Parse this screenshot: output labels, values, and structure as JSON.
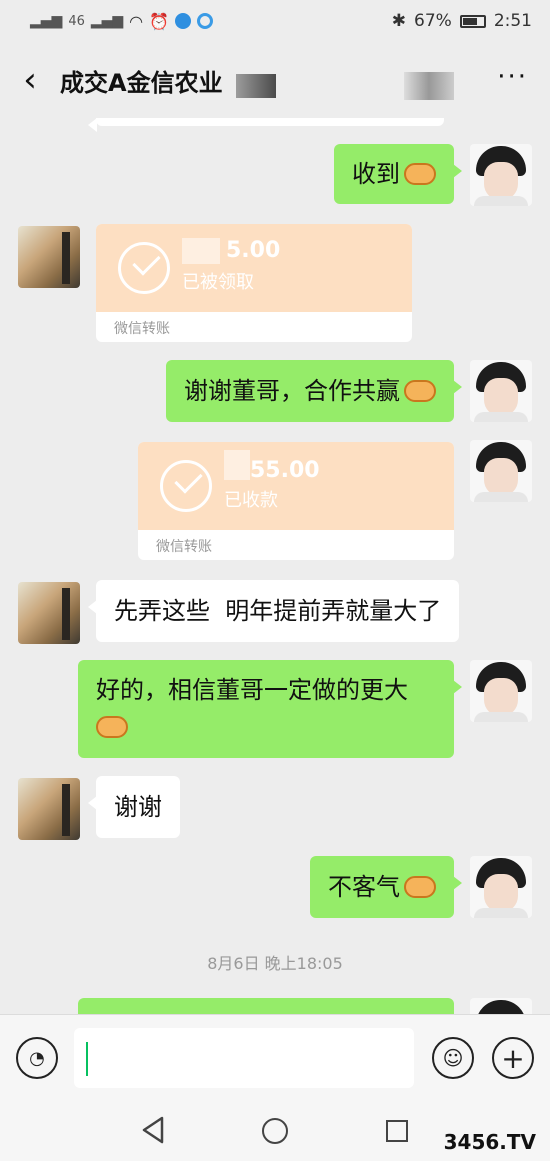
{
  "status_bar": {
    "network_left": "46",
    "bluetooth": "✱",
    "battery_percent": "67%",
    "time": "2:51"
  },
  "header": {
    "title": "成交A金信农业",
    "more_label": "···"
  },
  "messages": {
    "m1": "收到",
    "m2_amount": "5.00",
    "m2_status": "已被领取",
    "m2_footer": "微信转账",
    "m3": "谢谢董哥，合作共赢",
    "m4_amount": "55.00",
    "m4_status": "已收款",
    "m4_footer": "微信转账",
    "m5": "先弄这些  明年提前弄就量大了",
    "m6": "好的，相信董哥一定做的更大",
    "m7": "谢谢",
    "m8": "不客气",
    "timestamp": "8月6日 晚上18:05"
  },
  "input_bar": {
    "input_value": "",
    "voice_icon": "voice-icon",
    "emoji_icon": "emoji-icon",
    "add_icon": "add-icon",
    "add_label": "+"
  },
  "watermark": "3456.TV"
}
